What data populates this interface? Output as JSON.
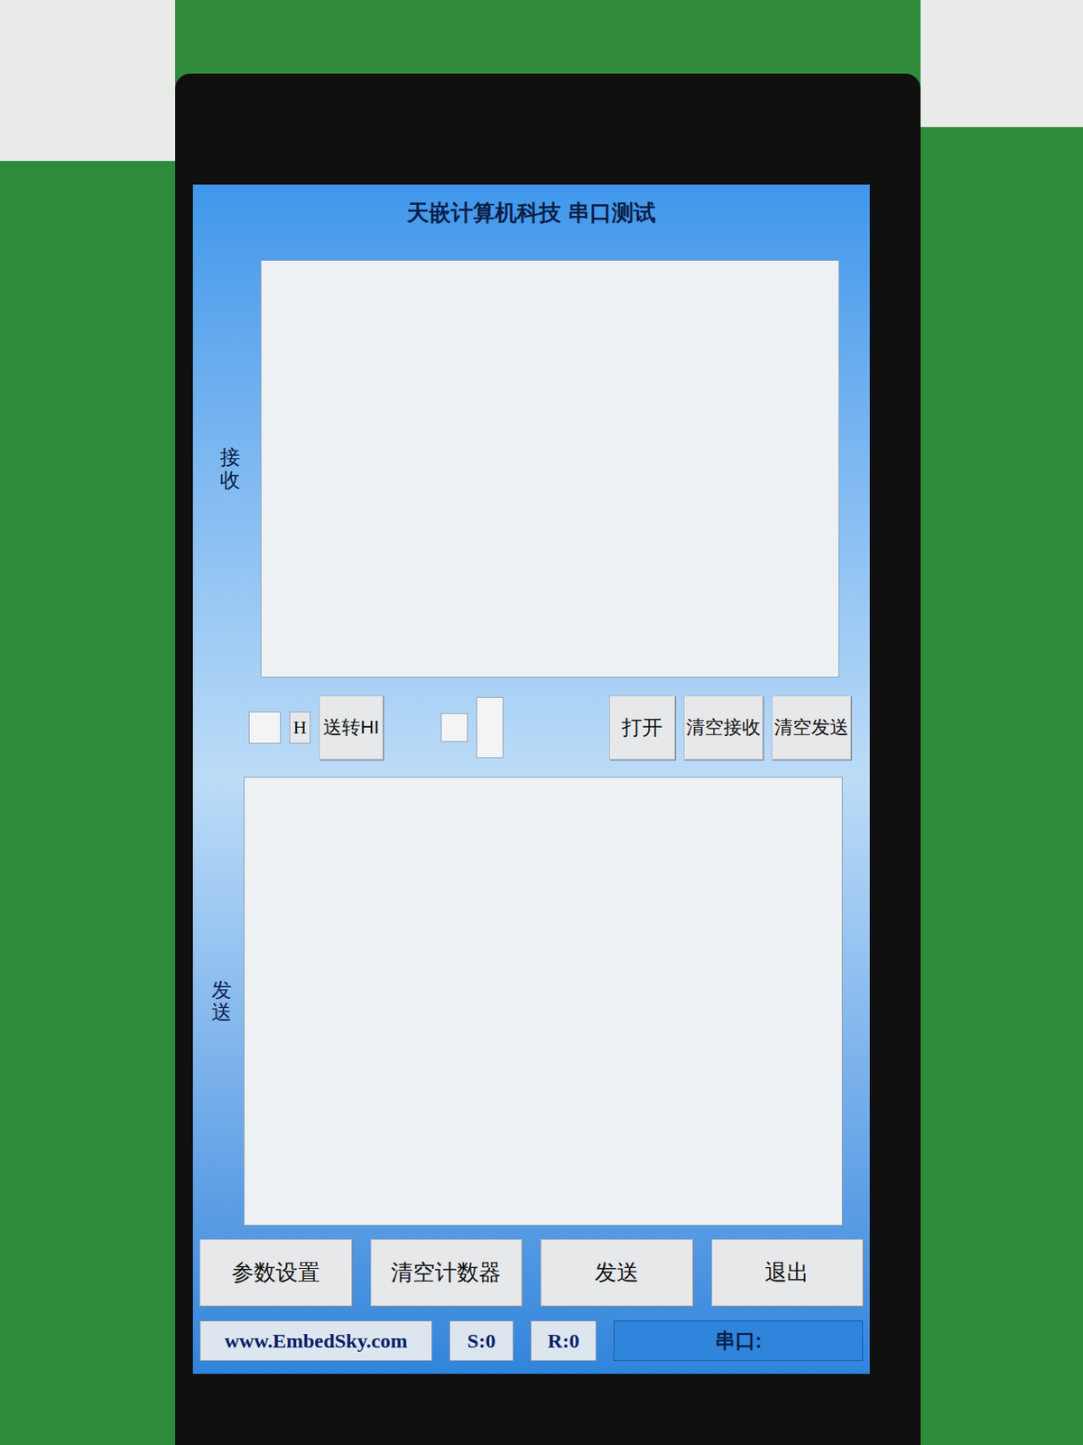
{
  "screen": {
    "title": "天嵌计算机科技 串口测试"
  },
  "receive": {
    "label": "接收",
    "content": ""
  },
  "controls": {
    "hex_receive": {
      "checked": false
    },
    "hex_label": "H",
    "hex_send_button": "送转HI",
    "option": {
      "checked": false
    },
    "open_button": "打开",
    "clear_receive_button": "清空接收",
    "clear_send_button": "清空发送"
  },
  "send": {
    "label": "发送",
    "content": ""
  },
  "buttons": [
    "参数设置",
    "清空计数器",
    "发送",
    "退出"
  ],
  "status_bar": {
    "website": "www.EmbedSky.com",
    "sent": "S:0",
    "received": "R:0",
    "port": "串口:"
  }
}
